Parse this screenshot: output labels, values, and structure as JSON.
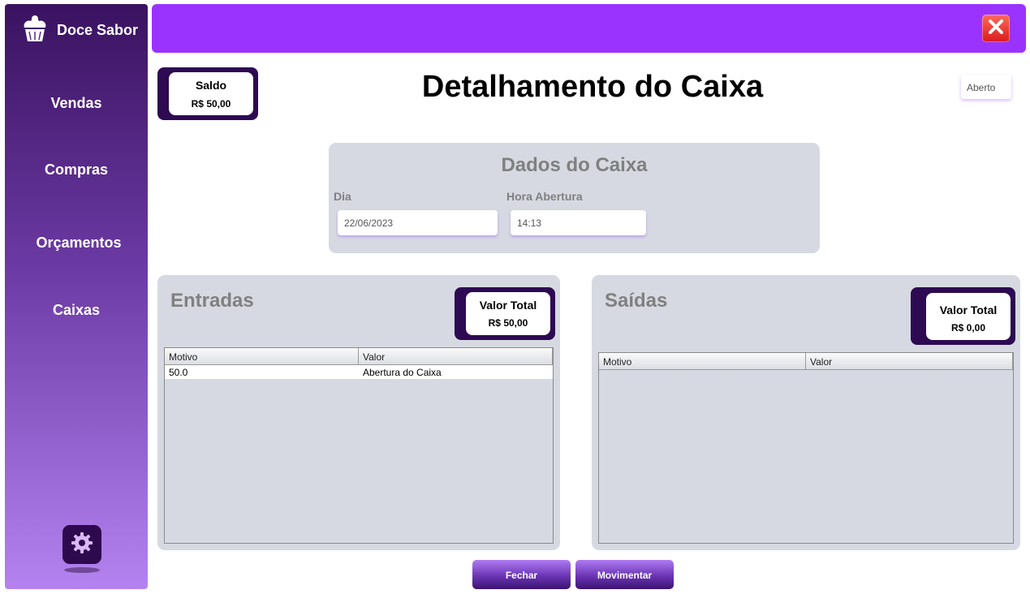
{
  "sidebar": {
    "brand": "Doce Sabor",
    "items": [
      {
        "label": "Vendas"
      },
      {
        "label": "Compras"
      },
      {
        "label": "Orçamentos"
      },
      {
        "label": "Caixas"
      }
    ]
  },
  "header": {
    "title": "Detalhamento do Caixa",
    "status": "Aberto"
  },
  "saldo": {
    "title": "Saldo",
    "value": "R$ 50,00"
  },
  "dados": {
    "heading": "Dados do Caixa",
    "dia_label": "Dia",
    "dia_value": "22/06/2023",
    "hora_label": "Hora Abertura",
    "hora_value": "14:13"
  },
  "entradas": {
    "heading": "Entradas",
    "total_title": "Valor Total",
    "total_value": "R$ 50,00",
    "columns": [
      "Motivo",
      "Valor"
    ],
    "rows": [
      [
        "50.0",
        "Abertura do Caixa"
      ]
    ]
  },
  "saidas": {
    "heading": "Saídas",
    "total_title": "Valor Total",
    "total_value": "R$ 0,00",
    "columns": [
      "Motivo",
      "Valor"
    ],
    "rows": []
  },
  "actions": {
    "close_label": "Fechar",
    "move_label": "Movimentar"
  },
  "colors": {
    "accent": "#9b33ff",
    "dark": "#2d0a52",
    "panel": "#d6d9e1"
  },
  "icons": {
    "brand": "cupcake-icon",
    "close": "close-icon",
    "settings": "gear-icon"
  }
}
